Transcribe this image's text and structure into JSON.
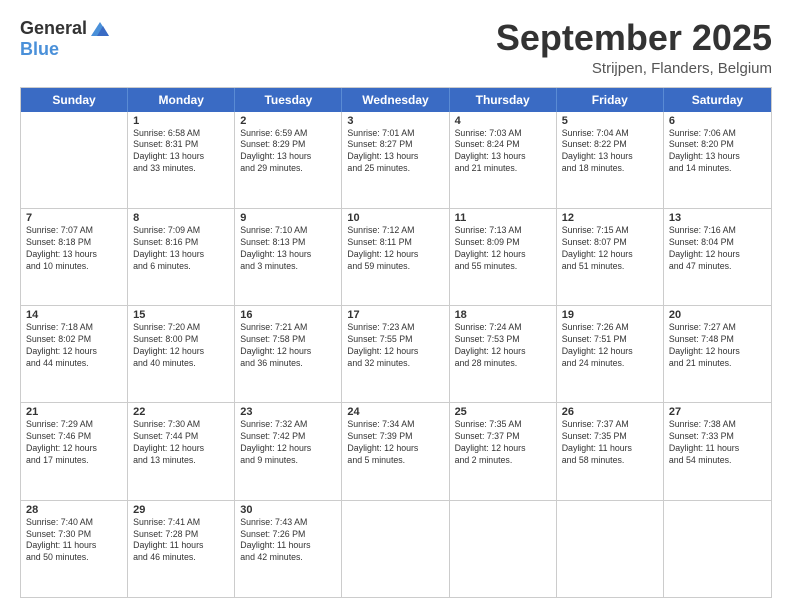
{
  "app": {
    "logo_general": "General",
    "logo_blue": "Blue"
  },
  "header": {
    "month": "September 2025",
    "location": "Strijpen, Flanders, Belgium"
  },
  "calendar": {
    "days_of_week": [
      "Sunday",
      "Monday",
      "Tuesday",
      "Wednesday",
      "Thursday",
      "Friday",
      "Saturday"
    ],
    "weeks": [
      [
        {
          "day": "",
          "data": ""
        },
        {
          "day": "1",
          "data": "Sunrise: 6:58 AM\nSunset: 8:31 PM\nDaylight: 13 hours\nand 33 minutes."
        },
        {
          "day": "2",
          "data": "Sunrise: 6:59 AM\nSunset: 8:29 PM\nDaylight: 13 hours\nand 29 minutes."
        },
        {
          "day": "3",
          "data": "Sunrise: 7:01 AM\nSunset: 8:27 PM\nDaylight: 13 hours\nand 25 minutes."
        },
        {
          "day": "4",
          "data": "Sunrise: 7:03 AM\nSunset: 8:24 PM\nDaylight: 13 hours\nand 21 minutes."
        },
        {
          "day": "5",
          "data": "Sunrise: 7:04 AM\nSunset: 8:22 PM\nDaylight: 13 hours\nand 18 minutes."
        },
        {
          "day": "6",
          "data": "Sunrise: 7:06 AM\nSunset: 8:20 PM\nDaylight: 13 hours\nand 14 minutes."
        }
      ],
      [
        {
          "day": "7",
          "data": "Sunrise: 7:07 AM\nSunset: 8:18 PM\nDaylight: 13 hours\nand 10 minutes."
        },
        {
          "day": "8",
          "data": "Sunrise: 7:09 AM\nSunset: 8:16 PM\nDaylight: 13 hours\nand 6 minutes."
        },
        {
          "day": "9",
          "data": "Sunrise: 7:10 AM\nSunset: 8:13 PM\nDaylight: 13 hours\nand 3 minutes."
        },
        {
          "day": "10",
          "data": "Sunrise: 7:12 AM\nSunset: 8:11 PM\nDaylight: 12 hours\nand 59 minutes."
        },
        {
          "day": "11",
          "data": "Sunrise: 7:13 AM\nSunset: 8:09 PM\nDaylight: 12 hours\nand 55 minutes."
        },
        {
          "day": "12",
          "data": "Sunrise: 7:15 AM\nSunset: 8:07 PM\nDaylight: 12 hours\nand 51 minutes."
        },
        {
          "day": "13",
          "data": "Sunrise: 7:16 AM\nSunset: 8:04 PM\nDaylight: 12 hours\nand 47 minutes."
        }
      ],
      [
        {
          "day": "14",
          "data": "Sunrise: 7:18 AM\nSunset: 8:02 PM\nDaylight: 12 hours\nand 44 minutes."
        },
        {
          "day": "15",
          "data": "Sunrise: 7:20 AM\nSunset: 8:00 PM\nDaylight: 12 hours\nand 40 minutes."
        },
        {
          "day": "16",
          "data": "Sunrise: 7:21 AM\nSunset: 7:58 PM\nDaylight: 12 hours\nand 36 minutes."
        },
        {
          "day": "17",
          "data": "Sunrise: 7:23 AM\nSunset: 7:55 PM\nDaylight: 12 hours\nand 32 minutes."
        },
        {
          "day": "18",
          "data": "Sunrise: 7:24 AM\nSunset: 7:53 PM\nDaylight: 12 hours\nand 28 minutes."
        },
        {
          "day": "19",
          "data": "Sunrise: 7:26 AM\nSunset: 7:51 PM\nDaylight: 12 hours\nand 24 minutes."
        },
        {
          "day": "20",
          "data": "Sunrise: 7:27 AM\nSunset: 7:48 PM\nDaylight: 12 hours\nand 21 minutes."
        }
      ],
      [
        {
          "day": "21",
          "data": "Sunrise: 7:29 AM\nSunset: 7:46 PM\nDaylight: 12 hours\nand 17 minutes."
        },
        {
          "day": "22",
          "data": "Sunrise: 7:30 AM\nSunset: 7:44 PM\nDaylight: 12 hours\nand 13 minutes."
        },
        {
          "day": "23",
          "data": "Sunrise: 7:32 AM\nSunset: 7:42 PM\nDaylight: 12 hours\nand 9 minutes."
        },
        {
          "day": "24",
          "data": "Sunrise: 7:34 AM\nSunset: 7:39 PM\nDaylight: 12 hours\nand 5 minutes."
        },
        {
          "day": "25",
          "data": "Sunrise: 7:35 AM\nSunset: 7:37 PM\nDaylight: 12 hours\nand 2 minutes."
        },
        {
          "day": "26",
          "data": "Sunrise: 7:37 AM\nSunset: 7:35 PM\nDaylight: 11 hours\nand 58 minutes."
        },
        {
          "day": "27",
          "data": "Sunrise: 7:38 AM\nSunset: 7:33 PM\nDaylight: 11 hours\nand 54 minutes."
        }
      ],
      [
        {
          "day": "28",
          "data": "Sunrise: 7:40 AM\nSunset: 7:30 PM\nDaylight: 11 hours\nand 50 minutes."
        },
        {
          "day": "29",
          "data": "Sunrise: 7:41 AM\nSunset: 7:28 PM\nDaylight: 11 hours\nand 46 minutes."
        },
        {
          "day": "30",
          "data": "Sunrise: 7:43 AM\nSunset: 7:26 PM\nDaylight: 11 hours\nand 42 minutes."
        },
        {
          "day": "",
          "data": ""
        },
        {
          "day": "",
          "data": ""
        },
        {
          "day": "",
          "data": ""
        },
        {
          "day": "",
          "data": ""
        }
      ]
    ]
  }
}
